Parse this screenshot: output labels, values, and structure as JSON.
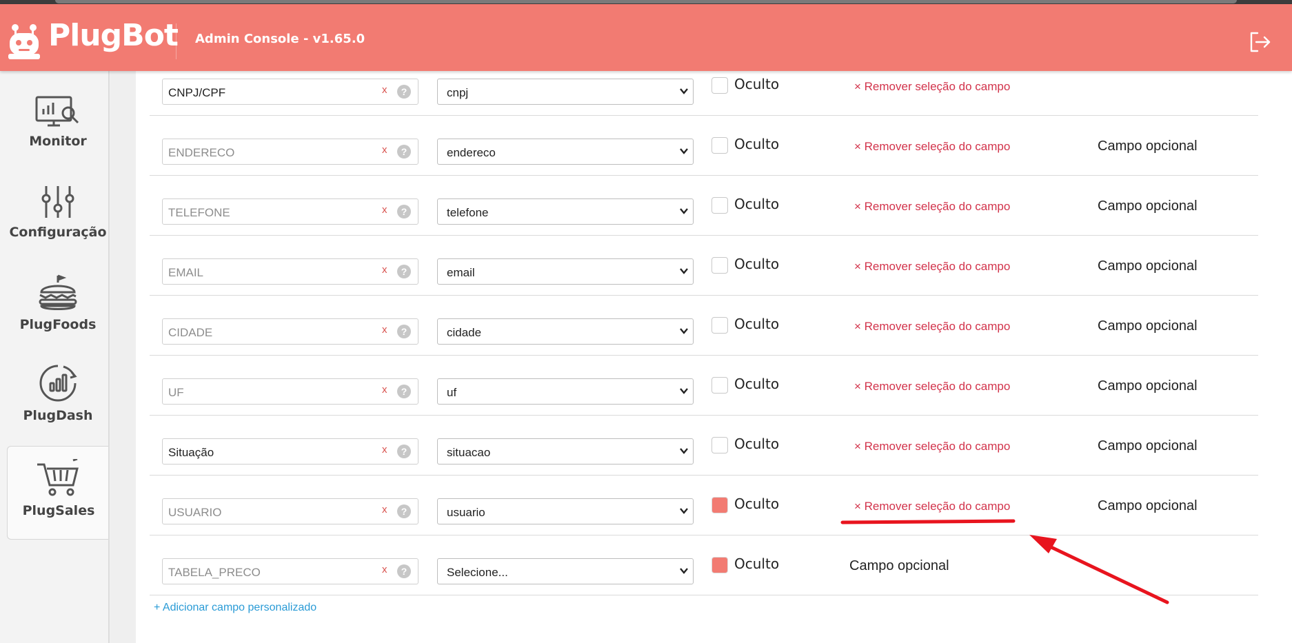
{
  "header": {
    "brand": "PlugBot",
    "console_title": "Admin Console - v1.65.0",
    "logout_icon": "logout-icon"
  },
  "sidebar": {
    "items": [
      {
        "label": "Monitor",
        "icon": "monitor-chart-icon"
      },
      {
        "label": "Configuração",
        "icon": "sliders-icon"
      },
      {
        "label": "PlugFoods",
        "icon": "burger-icon"
      },
      {
        "label": "PlugDash",
        "icon": "dashboard-chart-icon"
      },
      {
        "label": "PlugSales",
        "icon": "shopping-cart-icon",
        "active": true
      }
    ]
  },
  "fields": {
    "rows": [
      {
        "name": "CNPJ/CPF",
        "name_is_placeholder": false,
        "x": "x",
        "help": "?",
        "select": "cnpj",
        "checked": false,
        "oculto": "Oculto",
        "remove": "× Remover seleção do campo",
        "optional": ""
      },
      {
        "name": "ENDERECO",
        "name_is_placeholder": true,
        "x": "x",
        "help": "?",
        "select": "endereco",
        "checked": false,
        "oculto": "Oculto",
        "remove": "× Remover seleção do campo",
        "optional": "Campo opcional"
      },
      {
        "name": "TELEFONE",
        "name_is_placeholder": true,
        "x": "x",
        "help": "?",
        "select": "telefone",
        "checked": false,
        "oculto": "Oculto",
        "remove": "× Remover seleção do campo",
        "optional": "Campo opcional"
      },
      {
        "name": "EMAIL",
        "name_is_placeholder": true,
        "x": "x",
        "help": "?",
        "select": "email",
        "checked": false,
        "oculto": "Oculto",
        "remove": "× Remover seleção do campo",
        "optional": "Campo opcional"
      },
      {
        "name": "CIDADE",
        "name_is_placeholder": true,
        "x": "x",
        "help": "?",
        "select": "cidade",
        "checked": false,
        "oculto": "Oculto",
        "remove": "× Remover seleção do campo",
        "optional": "Campo opcional"
      },
      {
        "name": "UF",
        "name_is_placeholder": true,
        "x": "x",
        "help": "?",
        "select": "uf",
        "checked": false,
        "oculto": "Oculto",
        "remove": "× Remover seleção do campo",
        "optional": "Campo opcional"
      },
      {
        "name": "Situação",
        "name_is_placeholder": false,
        "x": "x",
        "help": "?",
        "select": "situacao",
        "checked": false,
        "oculto": "Oculto",
        "remove": "× Remover seleção do campo",
        "optional": "Campo opcional"
      },
      {
        "name": "USUARIO",
        "name_is_placeholder": true,
        "x": "x",
        "help": "?",
        "select": "usuario",
        "checked": true,
        "oculto": "Oculto",
        "remove": "× Remover seleção do campo",
        "optional": "Campo opcional"
      },
      {
        "name": "TABELA_PRECO",
        "name_is_placeholder": true,
        "x": "x",
        "help": "?",
        "select": "Selecione...",
        "checked": true,
        "oculto": "Oculto",
        "remove": "",
        "optional_mid": "Campo opcional"
      }
    ],
    "add_link": "+ Adicionar campo personalizado"
  },
  "colors": {
    "brand": "#f27b72",
    "remove_link": "#d2334b",
    "add_link": "#2a9bd6",
    "annotation": "#e8141e"
  }
}
